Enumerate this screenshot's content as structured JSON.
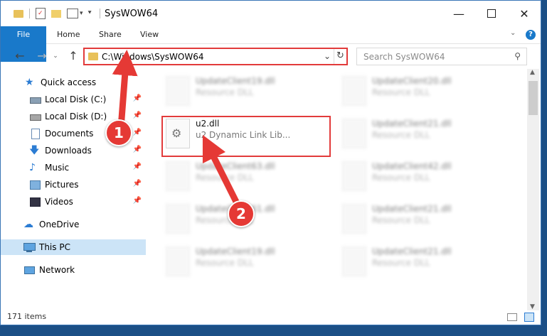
{
  "window": {
    "title": "SysWOW64"
  },
  "ribbon": {
    "tabs": [
      "File",
      "Home",
      "Share",
      "View"
    ]
  },
  "address": {
    "path": "C:\\Windows\\SysWOW64"
  },
  "search": {
    "placeholder": "Search SysWOW64"
  },
  "nav": {
    "items": [
      {
        "label": "Quick access",
        "icon": "star-icon"
      },
      {
        "label": "Local Disk (C:)",
        "icon": "drive-icon"
      },
      {
        "label": "Local Disk (D:)",
        "icon": "drive-icon"
      },
      {
        "label": "Documents",
        "icon": "documents-icon"
      },
      {
        "label": "Downloads",
        "icon": "download-icon"
      },
      {
        "label": "Music",
        "icon": "music-icon"
      },
      {
        "label": "Pictures",
        "icon": "pictures-icon"
      },
      {
        "label": "Videos",
        "icon": "videos-icon"
      },
      {
        "label": "OneDrive",
        "icon": "cloud-icon"
      },
      {
        "label": "This PC",
        "icon": "computer-icon"
      },
      {
        "label": "Network",
        "icon": "network-icon"
      }
    ]
  },
  "files": [
    {
      "name": "UpdateClient19.dll",
      "desc": "Resource DLL"
    },
    {
      "name": "UpdateClient20.dll",
      "desc": "Resource DLL"
    },
    {
      "name": "u2.dll",
      "desc": "u2 Dynamic Link Lib..."
    },
    {
      "name": "UpdateClient21.dll",
      "desc": "Resource DLL"
    },
    {
      "name": "UpdateClient63.dll",
      "desc": "Resource DLL"
    },
    {
      "name": "UpdateClient42.dll",
      "desc": "Resource DLL"
    },
    {
      "name": "UpdateClient61.dll",
      "desc": "Resource DLL"
    },
    {
      "name": "UpdateClient21.dll",
      "desc": "Resource DLL"
    },
    {
      "name": "UpdateClient19.dll",
      "desc": "Resource DLL"
    },
    {
      "name": "UpdateClient21.dll",
      "desc": "Resource DLL"
    }
  ],
  "status": {
    "count": "171 items"
  },
  "callouts": {
    "one": "1",
    "two": "2"
  },
  "colors": {
    "accent": "#1979ca",
    "highlight": "#e23b3b",
    "selected": "#cce4f7"
  }
}
